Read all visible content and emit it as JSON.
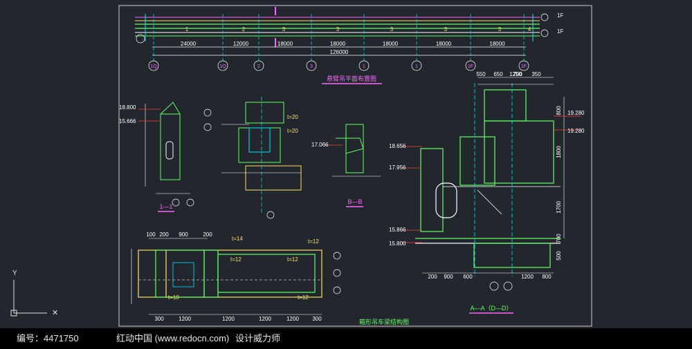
{
  "drawing": {
    "titles": {
      "plan": "悬臂吊平面布置图",
      "section_bb": "B—B",
      "section_11": "1—1",
      "section_aa": "A—A（D—D）",
      "box_beam": "箱形吊车梁结构图"
    },
    "plan_spans": [
      "24000",
      "12000",
      "18000",
      "18000",
      "18000",
      "18000",
      "18000"
    ],
    "plan_total": "126000",
    "plan_axes": [
      "1Q",
      "1Q",
      "2",
      "3",
      "1",
      "1",
      "1F",
      "1F"
    ],
    "beam_labels": [
      "1",
      "2",
      "3",
      "3",
      "3",
      "3",
      "3",
      "4"
    ],
    "elevations": [
      "18.800",
      "15.666",
      "17.066",
      "18.656",
      "17.956",
      "15.866",
      "15.800",
      "19.280",
      "19.280"
    ],
    "section_aa_top_dims": [
      "1250",
      "550",
      "650",
      "700",
      "350"
    ],
    "section_aa_side_dims": [
      "800",
      "1800",
      "1700",
      "700",
      "500"
    ],
    "section_aa_bottom_dims": [
      "200",
      "900",
      "600",
      "1200",
      "800"
    ],
    "box_beam_bottom_dims": [
      "300",
      "1200",
      "1200",
      "1200",
      "1200",
      "300"
    ],
    "box_beam_top_dims": [
      "100",
      "200",
      "900",
      "200"
    ],
    "plate_notes": [
      "t=14",
      "t=12",
      "t=12",
      "t=12",
      "t=10",
      "t=12",
      "t=20",
      "t=20",
      "t=12"
    ],
    "detail_dims": [
      "300",
      "400",
      "200",
      "900",
      "600",
      "150",
      "100",
      "50",
      "250",
      "1200"
    ],
    "ucs_label": "Y"
  },
  "footer": {
    "id_text": "编号：4471750",
    "site_text": "红动中国 (www.redocn.com)",
    "slogan_text": "设计威力师"
  }
}
